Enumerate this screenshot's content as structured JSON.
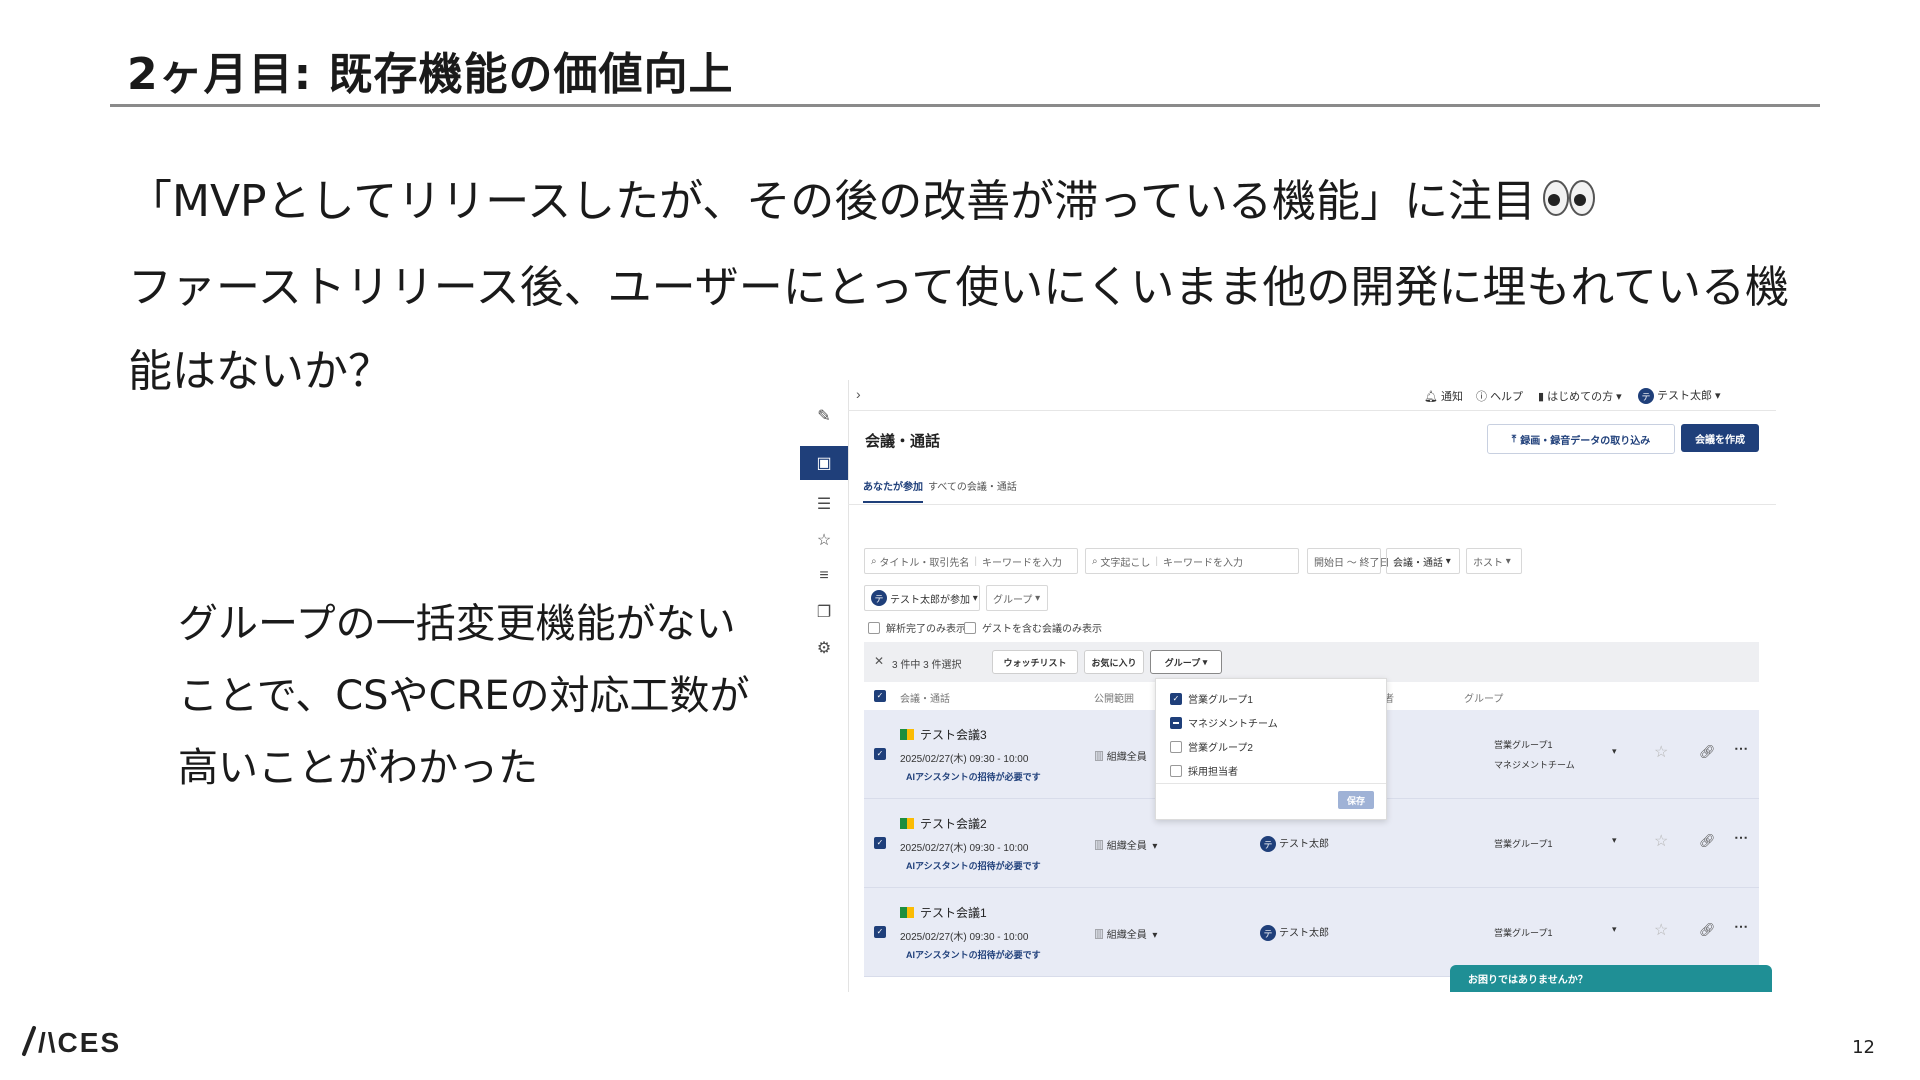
{
  "slide": {
    "title": "2ヶ月目: 既存機能の価値向上",
    "lines": [
      "「MVPとしてリリースしたが、その後の改善が滞っている機能」に注目",
      "ファーストリリース後、ユーザーにとって使いにくいまま他の開発に埋もれている機",
      "能はないか？"
    ],
    "side_lines": [
      "グループの一括変更機能がない",
      "ことで、CSやCREの対応工数が",
      "高いことがわかった"
    ],
    "logo": "/\\CES",
    "page_number": "12"
  },
  "app": {
    "topbar": {
      "notify": "通知",
      "help": "ヘルプ",
      "beginner": "はじめての方",
      "user_initial": "テ",
      "user": "テスト太郎"
    },
    "page_title": "会議・通話",
    "import_button": "録画・録音データの取り込み",
    "create_button": "会議を作成",
    "tabs": [
      "あなたが参加",
      "すべての会議・通話"
    ],
    "filters": {
      "title_label": "タイトル・取引先名",
      "title_placeholder": "キーワードを入力",
      "transcript_label": "文字起こし",
      "transcript_placeholder": "キーワードを入力",
      "date": "開始日 〜 終了日",
      "type": "会議・通話",
      "host": "ホスト",
      "participant": "テスト太郎が参加",
      "group": "グループ"
    },
    "checks": [
      "解析完了のみ表示",
      "ゲストを含む会議のみ表示"
    ],
    "selection": {
      "count": "3 件中 3 件選択",
      "watchlist": "ウォッチリスト",
      "favorite": "お気に入り",
      "group": "グループ"
    },
    "columns": [
      "会議・通話",
      "公開範囲",
      "者",
      "グループ"
    ],
    "rows": [
      {
        "name": "テスト会議3",
        "date": "2025/02/27(木) 09:30 - 10:00",
        "ai": "AIアシスタントの招待が必要です",
        "scope": "組織全員",
        "host": "",
        "groups": [
          "営業グループ1",
          "マネジメントチーム"
        ]
      },
      {
        "name": "テスト会議2",
        "date": "2025/02/27(木) 09:30 - 10:00",
        "ai": "AIアシスタントの招待が必要です",
        "scope": "組織全員",
        "host": "テスト太郎",
        "groups": [
          "営業グループ1"
        ]
      },
      {
        "name": "テスト会議1",
        "date": "2025/02/27(木) 09:30 - 10:00",
        "ai": "AIアシスタントの招待が必要です",
        "scope": "組織全員",
        "host": "テスト太郎",
        "groups": [
          "営業グループ1"
        ]
      }
    ],
    "group_popup": {
      "options": [
        {
          "label": "営業グループ1",
          "state": "checked"
        },
        {
          "label": "マネジメントチーム",
          "state": "mixed"
        },
        {
          "label": "営業グループ2",
          "state": "unchecked"
        },
        {
          "label": "採用担当者",
          "state": "unchecked"
        }
      ],
      "save": "保存"
    },
    "help_banner": "お困りではありませんか？",
    "accent_color": "#1f3f7a"
  }
}
